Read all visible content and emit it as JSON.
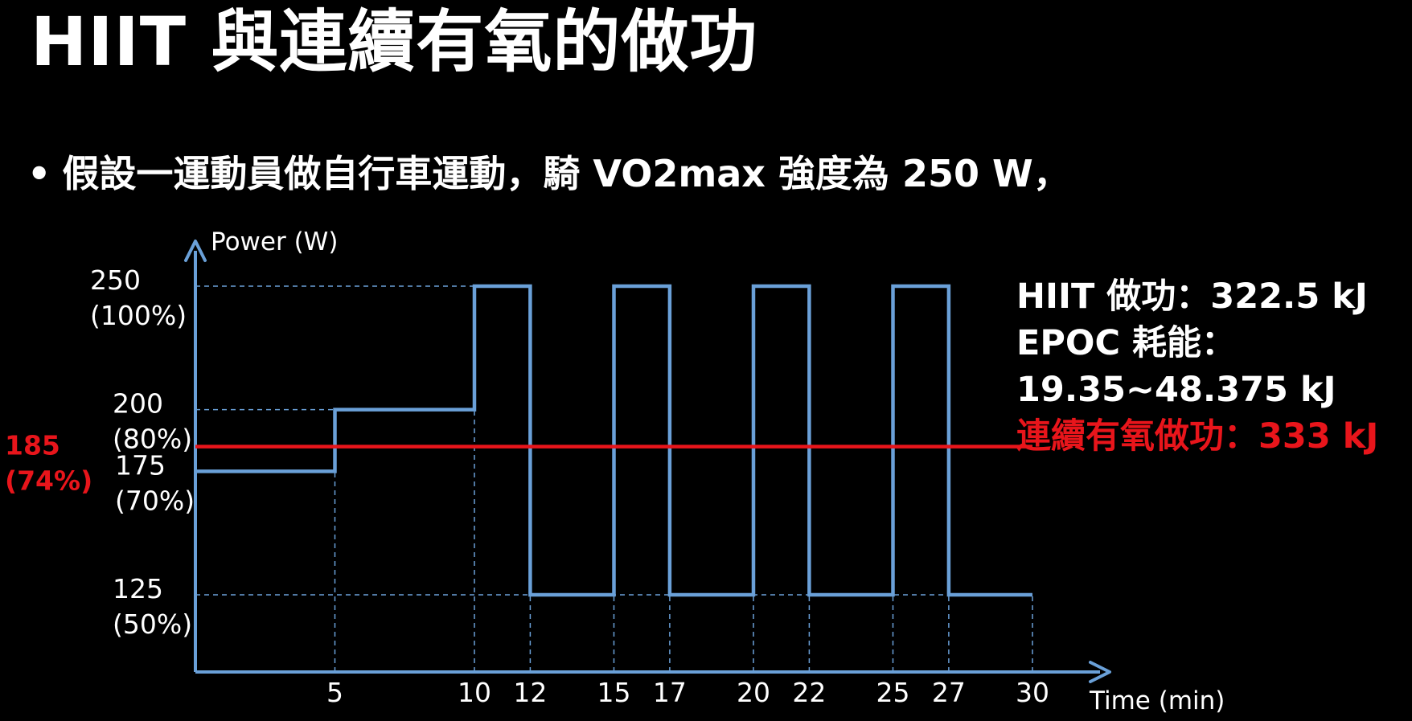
{
  "slide": {
    "title": "HIIT 與連續有氧的做功",
    "bullet_symbol": "•",
    "bullet_text": "假設一運動員做自行車運動，騎 VO2max 強度為 250 W，"
  },
  "info": {
    "hiit_work": "HIIT 做功：322.5 kJ",
    "epoc_label": "EPOC 耗能：",
    "epoc_value": "19.35~48.375 kJ",
    "continuous_work": "連續有氧做功：333 kJ"
  },
  "colors": {
    "background": "#000000",
    "text": "#ffffff",
    "hiit_line": "#6aa0d8",
    "continuous_line": "#e8151b",
    "axis": "#6aa0d8",
    "guide": "#6aa0d8"
  },
  "chart_data": {
    "type": "line",
    "xlabel": "Time (min)",
    "ylabel": "Power (W)",
    "xlim": [
      0,
      30
    ],
    "ylim": [
      125,
      250
    ],
    "x_ticks": [
      5,
      10,
      12,
      15,
      17,
      20,
      22,
      25,
      27,
      30
    ],
    "y_ticks": [
      {
        "value": 125,
        "line1": "125",
        "line2": "(50%)"
      },
      {
        "value": 175,
        "line1": "175",
        "line2": "(70%)"
      },
      {
        "value": 200,
        "line1": "200",
        "line2": "(80%)"
      },
      {
        "value": 250,
        "line1": "250",
        "line2": "(100%)"
      }
    ],
    "series": [
      {
        "style": "step",
        "color": "#6aa0d8",
        "points": [
          [
            0,
            175
          ],
          [
            5,
            175
          ],
          [
            5,
            200
          ],
          [
            10,
            200
          ],
          [
            10,
            250
          ],
          [
            12,
            250
          ],
          [
            12,
            125
          ],
          [
            15,
            125
          ],
          [
            15,
            250
          ],
          [
            17,
            250
          ],
          [
            17,
            125
          ],
          [
            20,
            125
          ],
          [
            20,
            250
          ],
          [
            22,
            250
          ],
          [
            22,
            125
          ],
          [
            25,
            125
          ],
          [
            25,
            250
          ],
          [
            27,
            250
          ],
          [
            27,
            125
          ],
          [
            30,
            125
          ]
        ]
      },
      {
        "style": "constant",
        "color": "#e8151b",
        "value": 185,
        "label_line1": "185",
        "label_line2": "(74%)"
      }
    ],
    "grid": "dashed guides at ticks",
    "legend": "none"
  }
}
